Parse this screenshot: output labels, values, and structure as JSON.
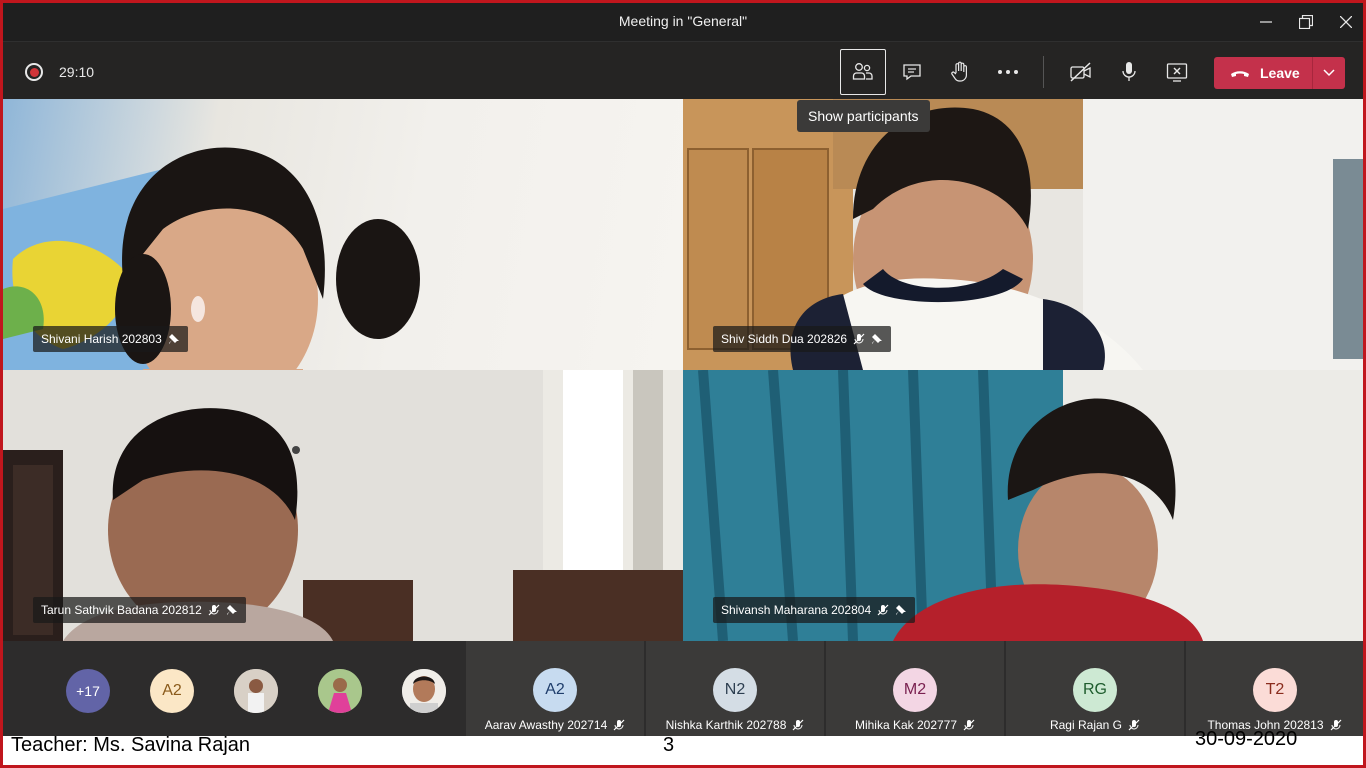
{
  "window": {
    "title": "Meeting in \"General\""
  },
  "toolbar": {
    "timer": "29:10",
    "tooltip": "Show participants",
    "leave_label": "Leave",
    "icons": [
      "participants-icon",
      "chat-icon",
      "raise-hand-icon",
      "more-icon",
      "camera-off-icon",
      "mic-icon",
      "stop-share-icon",
      "phone-hangup-icon",
      "chevron-down-icon"
    ]
  },
  "tiles": [
    {
      "name": "Shivani Harish 202803"
    },
    {
      "name": "Shiv Siddh Dua 202826"
    },
    {
      "name": "Tarun Sathvik Badana 202812"
    },
    {
      "name": "Shivansh Maharana 202804"
    }
  ],
  "roster_small": [
    {
      "initials": "+17",
      "bg": "#6264a7",
      "fg": "#ffffff"
    },
    {
      "initials": "A2",
      "bg": "#fbe7c6",
      "fg": "#8a5a1a"
    },
    {
      "initials": "",
      "photo": true
    },
    {
      "initials": "",
      "photo": true
    },
    {
      "initials": "",
      "photo": true
    }
  ],
  "roster_cards": [
    {
      "initials": "A2",
      "name": "Aarav Awasthy 202714",
      "bg": "#c7dbf0",
      "fg": "#1f3d6b"
    },
    {
      "initials": "N2",
      "name": "Nishka Karthik 202788",
      "bg": "#d4dde5",
      "fg": "#2c3e50"
    },
    {
      "initials": "M2",
      "name": "Mihika Kak 202777",
      "bg": "#f3d6e4",
      "fg": "#7a2150"
    },
    {
      "initials": "RG",
      "name": "Ragi Rajan G",
      "bg": "#cde9d3",
      "fg": "#1e5c2d"
    },
    {
      "initials": "T2",
      "name": "Thomas John 202813",
      "bg": "#fbdcd7",
      "fg": "#8a2c1d"
    }
  ],
  "footer": {
    "teacher": "Teacher: Ms. Savina Rajan",
    "page": "3",
    "date": "30-09-2020"
  },
  "colors": {
    "leave": "#c4314b",
    "record": "#d13438",
    "frame_border": "#c0161d"
  }
}
